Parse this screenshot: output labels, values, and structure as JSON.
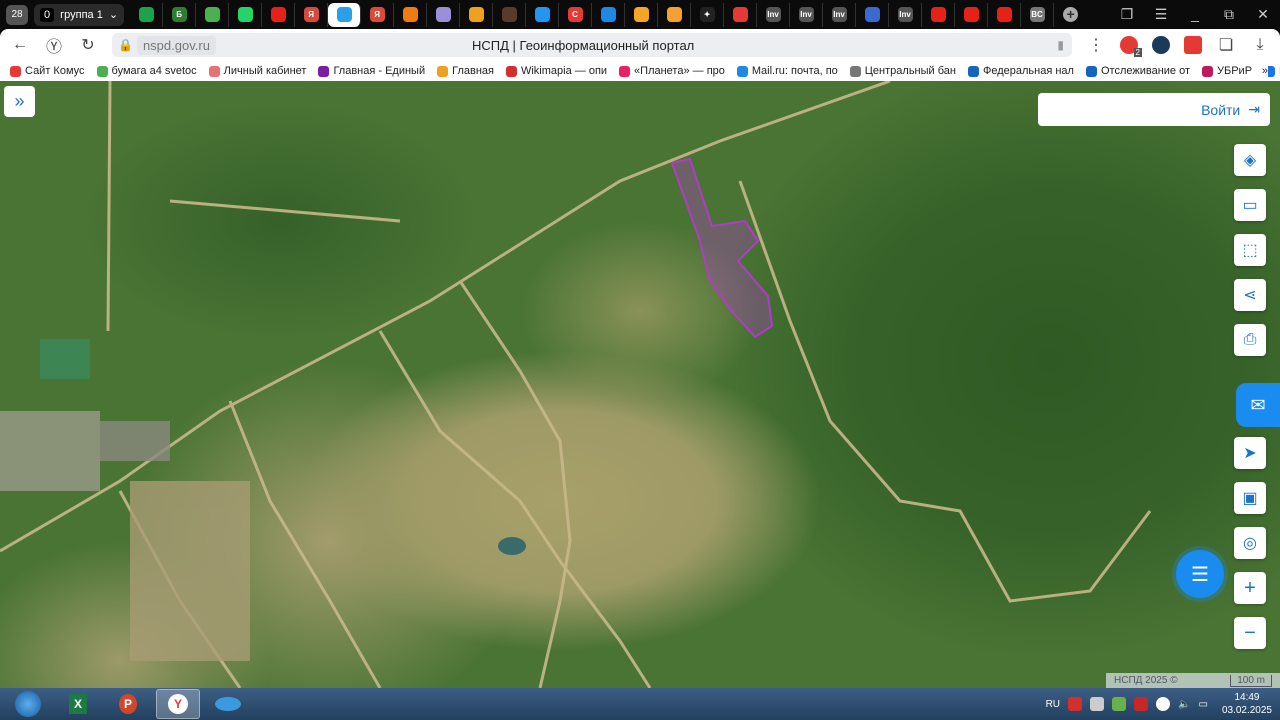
{
  "browser": {
    "tab_count": "28",
    "group": {
      "count": "0",
      "label": "группа 1"
    },
    "tabs": [
      {
        "icon": "sber-icon",
        "color": "#1aa34a",
        "text": ""
      },
      {
        "icon": "b-icon",
        "color": "#2e7d32",
        "text": "Б"
      },
      {
        "icon": "map-icon",
        "color": "#4caf50",
        "text": ""
      },
      {
        "icon": "whatsapp-icon",
        "color": "#25d366",
        "text": ""
      },
      {
        "icon": "youtube-icon",
        "color": "#e62117",
        "text": ""
      },
      {
        "icon": "yandex-icon",
        "color": "#d94a3a",
        "text": "Я"
      },
      {
        "icon": "nspd-icon",
        "color": "#29a0e8",
        "text": "",
        "active": true
      },
      {
        "icon": "yandex-icon",
        "color": "#d94a3a",
        "text": "Я"
      },
      {
        "icon": "fire-icon",
        "color": "#f07a14",
        "text": ""
      },
      {
        "icon": "sphere-icon",
        "color": "#9a8fd8",
        "text": ""
      },
      {
        "icon": "mail-icon",
        "color": "#f0a020",
        "text": ""
      },
      {
        "icon": "tool-icon",
        "color": "#5a3a2a",
        "text": ""
      },
      {
        "icon": "doc-icon",
        "color": "#2196f3",
        "text": ""
      },
      {
        "icon": "c-icon",
        "color": "#e53935",
        "text": "C"
      },
      {
        "icon": "mailru-icon",
        "color": "#1e88e5",
        "text": ""
      },
      {
        "icon": "app-icon",
        "color": "#f5a623",
        "text": ""
      },
      {
        "icon": "app-icon",
        "color": "#f5a030",
        "text": ""
      },
      {
        "icon": "star-icon",
        "color": "#222",
        "text": "✦"
      },
      {
        "icon": "music-icon",
        "color": "#e53935",
        "text": ""
      },
      {
        "icon": "inv-icon",
        "color": "#555",
        "text": "Inv"
      },
      {
        "icon": "inv-icon",
        "color": "#555",
        "text": "Inv"
      },
      {
        "icon": "inv-icon",
        "color": "#555",
        "text": "Inv"
      },
      {
        "icon": "pencil-icon",
        "color": "#3a6ad0",
        "text": ""
      },
      {
        "icon": "inv-icon",
        "color": "#555",
        "text": "Inv"
      },
      {
        "icon": "youtube-icon",
        "color": "#e62117",
        "text": ""
      },
      {
        "icon": "youtube-icon",
        "color": "#e62117",
        "text": ""
      },
      {
        "icon": "youtube-icon",
        "color": "#e62117",
        "text": ""
      },
      {
        "icon": "bc-icon",
        "color": "#777",
        "text": "BC"
      }
    ],
    "domain": "nspd.gov.ru",
    "page_title": "НСПД | Геоинформационный портал",
    "ext_badge": "2",
    "bookmarks": [
      {
        "label": "Сайт Комус",
        "color": "#e53935"
      },
      {
        "label": "бумага а4 svetoc",
        "color": "#4caf50"
      },
      {
        "label": "Личный кабинет",
        "color": "#e57373"
      },
      {
        "label": "Главная - Единый",
        "color": "#7b1fa2"
      },
      {
        "label": "Главная",
        "color": "#f0a020"
      },
      {
        "label": "Wikimapia — опи",
        "color": "#d32f2f"
      },
      {
        "label": "«Планета» — про",
        "color": "#e91e63"
      },
      {
        "label": "Mail.ru: почта, по",
        "color": "#1e88e5"
      },
      {
        "label": "Центральный бан",
        "color": "#777"
      },
      {
        "label": "Федеральная нал",
        "color": "#1565c0"
      },
      {
        "label": "Отслеживание от",
        "color": "#1565c0"
      },
      {
        "label": "УБРиР",
        "color": "#c2185b"
      },
      {
        "label": "L",
        "color": "#1a73e8"
      }
    ],
    "more": "»"
  },
  "map": {
    "login_label": "Войти",
    "copyright": "НСПД 2025 ©",
    "scale": "100 m",
    "parcel_color": "#b03cc8"
  },
  "taskbar": {
    "lang": "RU",
    "time": "14:49",
    "date": "03.02.2025"
  }
}
